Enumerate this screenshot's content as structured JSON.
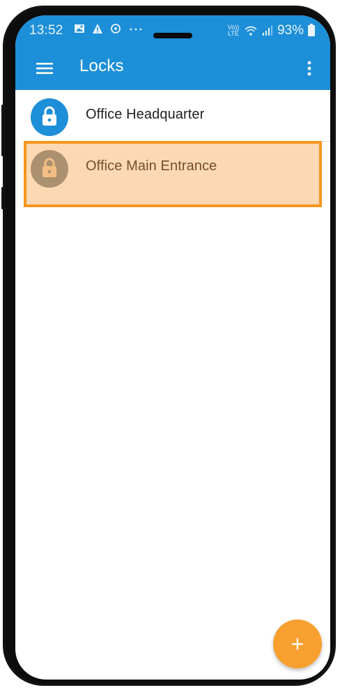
{
  "status_bar": {
    "time": "13:52",
    "network_label": "VoLTE",
    "network_text_top": "Vo))",
    "network_text_bottom": "LTE",
    "battery": "93%",
    "left_icons": [
      "image-icon",
      "warning-icon",
      "sync-icon",
      "more-notifications-icon"
    ],
    "right_icons": [
      "volte-icon",
      "wifi-icon",
      "signal-icon",
      "battery-icon"
    ]
  },
  "app_bar": {
    "title": "Locks",
    "menu_icon": "hamburger-menu-icon",
    "overflow_icon": "more-vertical-icon"
  },
  "locks": [
    {
      "name": "Office Headquarter",
      "color": "#1d8fd8",
      "state": "active"
    },
    {
      "name": "Office Main Entrance",
      "color": "#7f8b93",
      "state": "selected"
    }
  ],
  "fab": {
    "label": "+",
    "icon": "add-icon",
    "color": "#f7a030"
  },
  "colors": {
    "primary": "#1d8fd8",
    "highlight": "#f5961f",
    "accent": "#f7a030"
  }
}
